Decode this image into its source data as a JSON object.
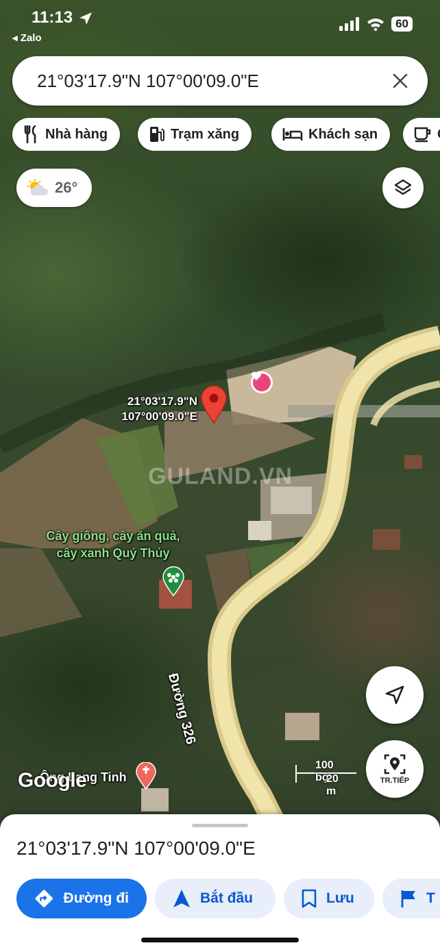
{
  "status_bar": {
    "time": "11:13",
    "back_app": "◂ Zalo",
    "battery": "60"
  },
  "search": {
    "query": "21°03'17.9\"N 107°00'09.0\"E"
  },
  "chips": [
    {
      "label": "Nhà hàng",
      "icon": "restaurant-icon"
    },
    {
      "label": "Trạm xăng",
      "icon": "gas-station-icon"
    },
    {
      "label": "Khách sạn",
      "icon": "hotel-icon"
    },
    {
      "label": "C",
      "icon": "coffee-icon"
    }
  ],
  "weather": {
    "temperature": "26°",
    "icon": "partly-cloudy-icon"
  },
  "map": {
    "pin_label_line1": "21°03'17.9\"N",
    "pin_label_line2": "107°00'09.0\"E",
    "poi_nursery_line1": "Cây giống, cây ăn quả,",
    "poi_nursery_line2": "cây xanh Quý Thủy",
    "road_label": "Đường 326",
    "poi_bottom": "Ông Lang Tinh",
    "watermark": "GULAND.VN",
    "google_logo": "Google",
    "scale_imperial": "100 bộ",
    "scale_metric": "20 m",
    "road_color": "#f5e9b0",
    "pin_color": "#ea4335"
  },
  "buttons": {
    "live_view_label": "TR.TIẾP"
  },
  "sheet": {
    "title": "21°03'17.9\"N 107°00'09.0\"E",
    "actions": [
      {
        "label": "Đường đi",
        "icon": "directions-icon",
        "style": "primary"
      },
      {
        "label": "Bắt đầu",
        "icon": "navigation-arrow-icon",
        "style": "secondary"
      },
      {
        "label": "Lưu",
        "icon": "bookmark-icon",
        "style": "secondary"
      },
      {
        "label": "T",
        "icon": "flag-icon",
        "style": "secondary"
      }
    ]
  },
  "colors": {
    "accent": "#1a73e8",
    "secondary_button_bg": "#e8eefa"
  }
}
